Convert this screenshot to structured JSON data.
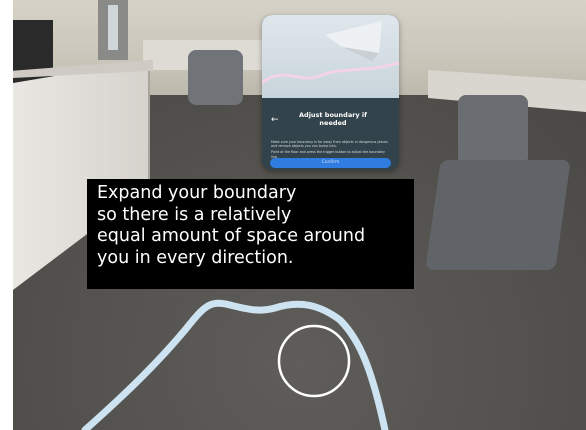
{
  "guardian_panel": {
    "back_icon": "arrow-left-icon",
    "title": "Adjust boundary if needed",
    "description_lines": [
      "Make sure your boundary is far away from objects in dangerous",
      "places and remove objects you can bump into.",
      "Point at the floor and press the trigger button to adjust the",
      "boundary line."
    ],
    "confirm_label": "Confirm"
  },
  "caption": {
    "text": "Expand your boundary\nso there is a relatively\nequal amount of space around\nyou in every direction."
  },
  "boundary": {
    "line_color": "#cde3f2",
    "cursor_ring_color": "#ffffff"
  },
  "colors": {
    "caption_background": "#000000",
    "panel_body": "#33434b",
    "confirm_button": "#2f7de0"
  }
}
